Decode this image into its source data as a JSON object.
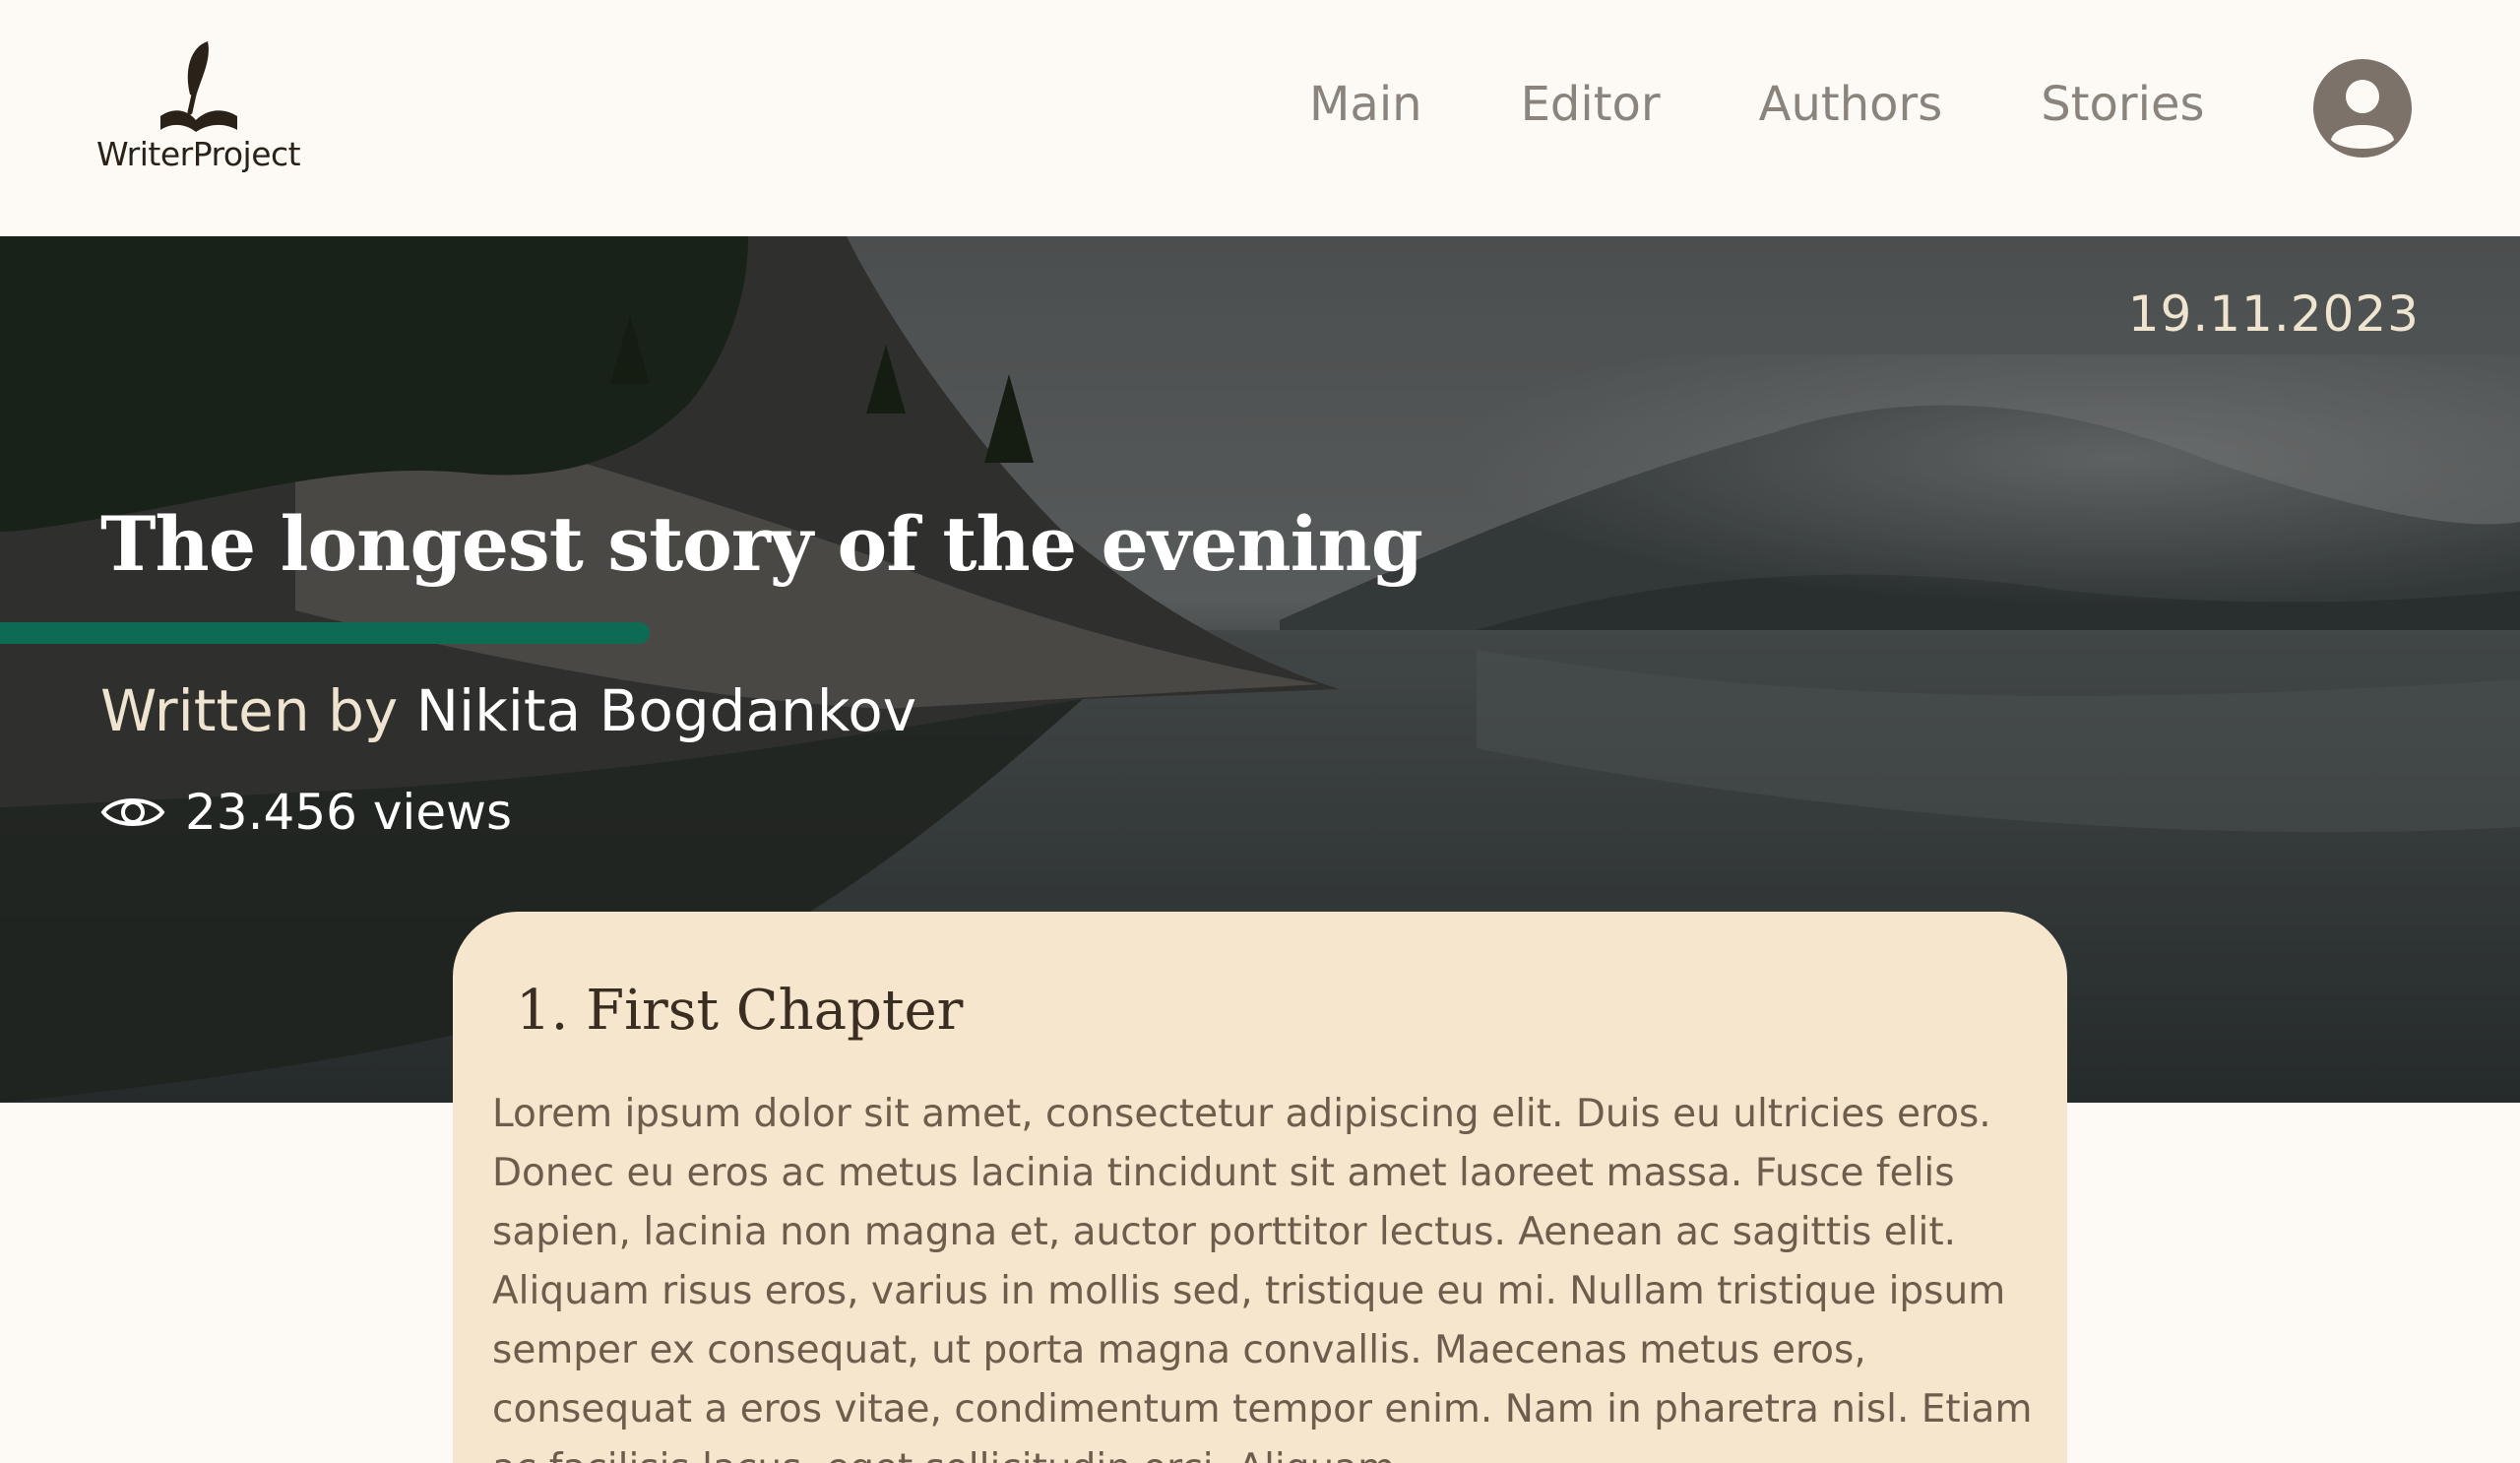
{
  "header": {
    "logo_text": "WriterProject",
    "nav": [
      "Main",
      "Editor",
      "Authors",
      "Stories"
    ]
  },
  "hero": {
    "date": "19.11.2023",
    "title": "The longest story of the evening",
    "byline_prefix": "Written by ",
    "author": "Nikita Bogdankov",
    "views": "23.456 views"
  },
  "chapter": {
    "title": "1. First Chapter",
    "body": "Lorem ipsum dolor sit amet, consectetur adipiscing elit. Duis eu ultricies eros. Donec eu eros ac metus lacinia tincidunt sit amet laoreet massa. Fusce felis sapien, lacinia non magna et, auctor porttitor lectus. Aenean ac sagittis elit. Aliquam risus eros, varius in mollis sed, tristique eu mi. Nullam tristique ipsum semper ex consequat, ut porta magna convallis. Maecenas metus eros, consequat a eros vitae, condimentum tempor enim. Nam in pharetra nisl. Etiam ac facilisis lacus, eget sollicitudin orci. Aliquam"
  },
  "colors": {
    "background": "#fdfaf5",
    "accent": "#0c6b52",
    "card": "#f6e6cd",
    "nav_text": "#8a847d"
  },
  "icons": {
    "logo": "quill-pen-icon",
    "avatar": "user-avatar-icon",
    "views": "eye-icon"
  }
}
